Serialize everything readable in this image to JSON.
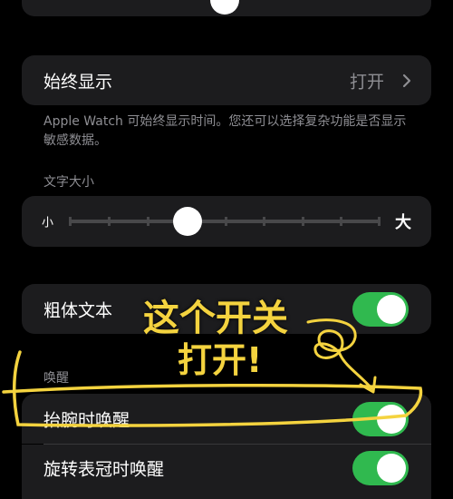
{
  "top_slider_card": {},
  "always_on": {
    "label": "始终显示",
    "value": "打开"
  },
  "always_on_note": "Apple Watch 可始终显示时间。您还可以选择复杂功能是否显示敏感数据。",
  "text_size": {
    "section_title": "文字大小",
    "small_label": "小",
    "large_label": "大",
    "level": 0.38
  },
  "bold_text": {
    "label": "粗体文本",
    "on": true
  },
  "wake": {
    "section_title": "唤醒",
    "raise_label": "抬腕时唤醒",
    "raise_on": true,
    "crown_label": "旋转表冠时唤醒",
    "crown_on": true
  },
  "annotation": {
    "line1": "这个开关",
    "line2": "打开!",
    "color": "#f4d33f"
  },
  "colors": {
    "toggle_on": "#30b94f",
    "card_bg": "#1c1c1e",
    "secondary_text": "#8e8e93"
  }
}
